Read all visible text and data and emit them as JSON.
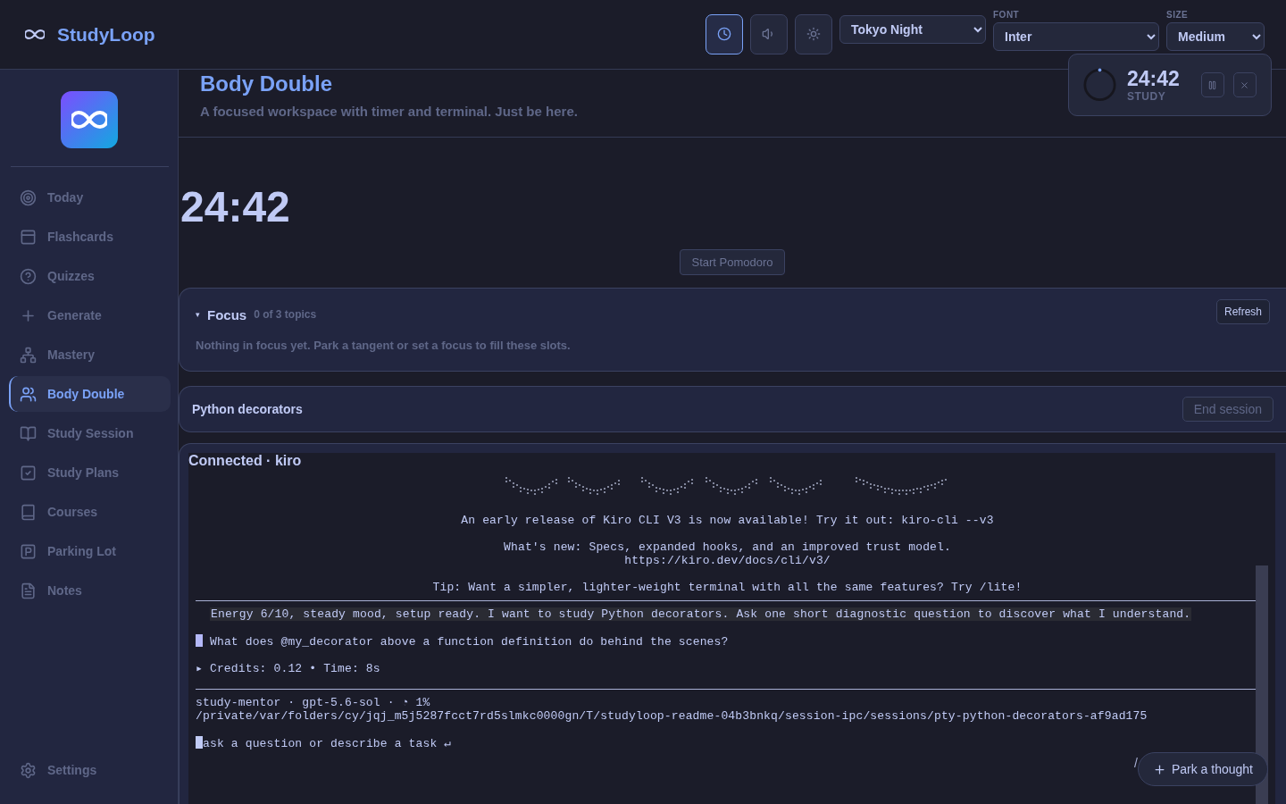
{
  "app": {
    "name": "StudyLoop"
  },
  "toolbar": {
    "buttons": [
      {
        "kind": "timer",
        "selected": true
      },
      {
        "kind": "sound",
        "selected": false
      },
      {
        "kind": "theme",
        "selected": false
      }
    ],
    "theme_select": {
      "value": "Tokyo Night"
    },
    "font_select": {
      "label": "FONT",
      "value": "Inter"
    },
    "size_select": {
      "label": "SIZE",
      "value": "Medium"
    }
  },
  "sidebar": {
    "items": [
      {
        "label": "Today",
        "selected": false
      },
      {
        "label": "Flashcards",
        "selected": false
      },
      {
        "label": "Quizzes",
        "selected": false
      },
      {
        "label": "Generate",
        "selected": false
      },
      {
        "label": "Mastery",
        "selected": false
      },
      {
        "label": "Body Double",
        "selected": true
      },
      {
        "label": "Study Session",
        "selected": false
      },
      {
        "label": "Study Plans",
        "selected": false
      },
      {
        "label": "Courses",
        "selected": false
      },
      {
        "label": "Parking Lot",
        "selected": false
      },
      {
        "label": "Notes",
        "selected": false
      }
    ],
    "settings": {
      "label": "Settings"
    }
  },
  "page": {
    "title": "Body Double",
    "subtitle": "A focused workspace with timer and terminal. Just be here."
  },
  "timer_widget": {
    "time": "24:42",
    "mode": "STUDY"
  },
  "timer": {
    "time": "24:42",
    "start_button": "Start Pomodoro"
  },
  "focus": {
    "toggle": "▾",
    "title": "Focus",
    "expanded": true,
    "count": "0 of 3 topics",
    "refresh_button": "Refresh",
    "empty_text": "Nothing in focus yet. Park a tangent or set a focus to fill these slots."
  },
  "session": {
    "topic": "Python decorators",
    "end_button": "End session"
  },
  "terminal": {
    "title": "Connected · kiro",
    "banner": [
      {
        "lines": [
          "An early release of Kiro CLI V3 is now available! Try it out: kiro-cli --v3"
        ]
      },
      {
        "lines": [
          "What's new: Specs, expanded hooks, and an improved trust model.",
          "https://kiro.dev/docs/cli/v3/"
        ]
      },
      {
        "lines": [
          "Tip: Want a simpler, lighter-weight terminal with all the same features? Try /lite!"
        ]
      }
    ],
    "user_message": "Energy 6/10, steady mood, setup ready. I want to study Python decorators. Ask one short diagnostic question to discover what I understand.",
    "reply": "What does @my_decorator above a function definition do behind the scenes?",
    "credits": "▸ Credits: 0.12 • Time: 8s",
    "status": "study-mentor · gpt-5.6-sol · ◔ 1%",
    "path": "/private/var/folders/cy/jqj_m5j5287fcct7rd5slmkc0000gn/T/studyloop-readme-04b3bnkq/session-ipc/sessions/pty-python-decorators-af9ad175",
    "placeholder": "ask a question or describe a task ↵",
    "stray": "/"
  },
  "park_button": {
    "label": "Park a thought"
  }
}
